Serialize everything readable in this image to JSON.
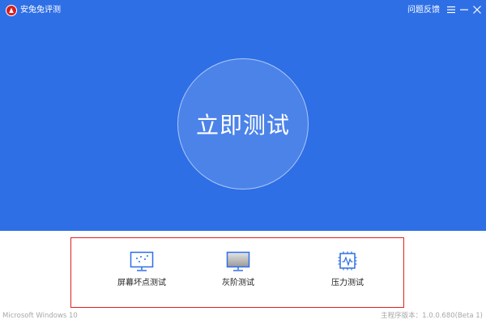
{
  "window": {
    "title": "安兔兔评测",
    "feedback_label": "问题反馈"
  },
  "main": {
    "start_button_label": "立即测试"
  },
  "tests": [
    {
      "label": "屏幕坏点测试",
      "icon": "monitor-dots-icon"
    },
    {
      "label": "灰阶测试",
      "icon": "monitor-gray-icon"
    },
    {
      "label": "压力测试",
      "icon": "chip-pulse-icon"
    }
  ],
  "footer": {
    "os": "Microsoft Windows 10",
    "version": "主程序版本：1.0.0.680(Beta 1)"
  },
  "colors": {
    "primary_blue": "#2e6fe6",
    "icon_blue": "#2e6fe6",
    "highlight_red": "#e02020"
  }
}
